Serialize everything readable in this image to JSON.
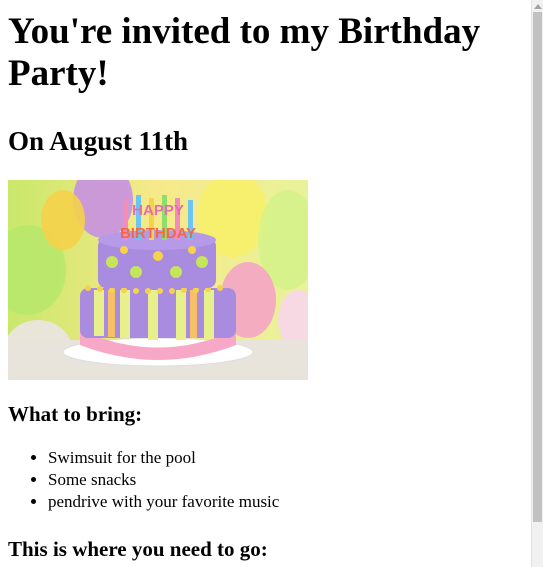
{
  "heading": "You're invited to my Birthday Party!",
  "date": "On August 11th",
  "image": {
    "alt": "Birthday cake",
    "cake_text": "HAPPY BIRTHDAY"
  },
  "bring": {
    "title": "What to bring:",
    "items": [
      "Swimsuit for the pool",
      "Some snacks",
      "pendrive with your favorite music"
    ]
  },
  "where_title": "This is where you need to go:",
  "colors": {
    "text": "#000000",
    "background": "#ffffff"
  }
}
